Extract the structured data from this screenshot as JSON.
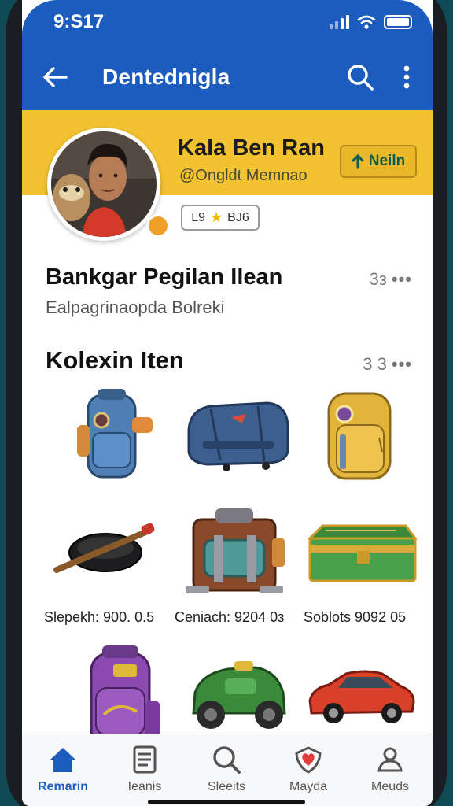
{
  "status": {
    "time": "9:S17"
  },
  "appbar": {
    "title": "Dentednigla"
  },
  "profile": {
    "name": "Kala Ben  Ran",
    "handle": "@Ongldt Memnao",
    "follow_label": "Neiln",
    "stat_left": "L9",
    "stat_right": "BJ6"
  },
  "section1": {
    "title": "Bankgar Pegilan Ilean",
    "subtitle": "Ealpagrinaopda Bolreki",
    "count": "3з"
  },
  "section2": {
    "title": "Kolexin Iten",
    "count": "3 3"
  },
  "items": [
    {
      "name": "blue-backpack"
    },
    {
      "name": "blue-suitcase"
    },
    {
      "name": "yellow-backpack"
    },
    {
      "name": "black-bag-with-stick"
    },
    {
      "name": "brown-trunk"
    },
    {
      "name": "green-chest"
    },
    {
      "name": "purple-backpack"
    },
    {
      "name": "green-car-bag"
    },
    {
      "name": "red-car"
    }
  ],
  "captions": [
    "Slepekh: 900. 0.5",
    "Ceniach: 9204 0з",
    "Soblots 9092 05"
  ],
  "tabs": [
    {
      "label": "Remarin",
      "icon": "home-icon"
    },
    {
      "label": "Ieanis",
      "icon": "document-icon"
    },
    {
      "label": "Sleeits",
      "icon": "search-icon"
    },
    {
      "label": "Mayda",
      "icon": "heart-shield-icon"
    },
    {
      "label": "Meuds",
      "icon": "profile-icon"
    }
  ],
  "colors": {
    "primary": "#1c5cbf",
    "banner": "#f2c230",
    "accent": "#f0a12a"
  }
}
